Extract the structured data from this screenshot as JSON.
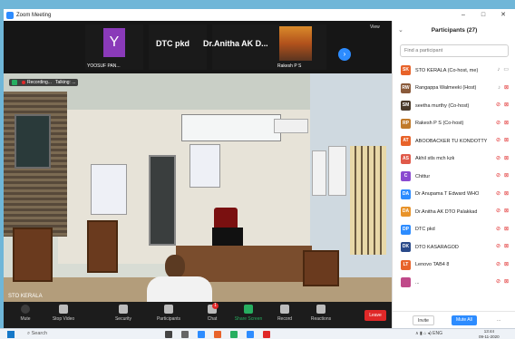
{
  "window": {
    "title": "Zoom Meeting",
    "controls": [
      "–",
      "□",
      "✕"
    ]
  },
  "gallery": {
    "tiles": [
      {
        "name": "YOOSUF PAN...",
        "avatar_letter": "Y",
        "avatar_color": "#8a3ab9"
      },
      {
        "name": "DTC pkd"
      },
      {
        "name": "Dr.Anitha AK D..."
      },
      {
        "name": "Rakesh P S"
      }
    ],
    "view_label": "View",
    "next_icon": "chevron-right-icon"
  },
  "main_video": {
    "recording_label": "Recording...",
    "talking_label": "Talking: ...",
    "speaker_name": "STO KERALA"
  },
  "toolbar": {
    "mute": "Mute",
    "stop_video": "Stop Video",
    "security": "Security",
    "participants": "Participants",
    "participants_count": "27",
    "chat": "Chat",
    "chat_badge": "1",
    "share_screen": "Share Screen",
    "record": "Record",
    "reactions": "Reactions",
    "leave": "Leave"
  },
  "panel": {
    "title": "Participants (27)",
    "search_placeholder": "Find a participant",
    "participants": [
      {
        "initials": "SK",
        "name": "STO KERALA (Co-host, me)",
        "color": "#e8632a",
        "mic_muted": false,
        "video_off": false
      },
      {
        "initials": "RW",
        "name": "Rangappa Walmeeki (Host)",
        "color": "#8a5a3a",
        "mic_muted": false,
        "video_off": true
      },
      {
        "initials": "SM",
        "name": "seetha murthy (Co-host)",
        "color": "#4a3a2a",
        "mic_muted": true,
        "video_off": true
      },
      {
        "initials": "RP",
        "name": "Rakesh P S (Co-host)",
        "color": "#c07a2a",
        "mic_muted": true,
        "video_off": true
      },
      {
        "initials": "AT",
        "name": "ABOOBACKER TU KONDOTTY",
        "color": "#e8632a",
        "mic_muted": true,
        "video_off": true
      },
      {
        "initials": "AS",
        "name": "Akhil stls mch kzk",
        "color": "#e05a4a",
        "mic_muted": true,
        "video_off": true
      },
      {
        "initials": "C",
        "name": "Chittur",
        "color": "#8a4ad0",
        "mic_muted": true,
        "video_off": true
      },
      {
        "initials": "DA",
        "name": "Dr Anupama T Edward WHO",
        "color": "#2d8cff",
        "mic_muted": true,
        "video_off": true
      },
      {
        "initials": "DA",
        "name": "Dr.Anitha AK DTO Palakkad",
        "color": "#e8932a",
        "mic_muted": true,
        "video_off": true
      },
      {
        "initials": "DP",
        "name": "DTC pkd",
        "color": "#2d8cff",
        "mic_muted": true,
        "video_off": true
      },
      {
        "initials": "DK",
        "name": "DTO KASARAGOD",
        "color": "#2a4a8a",
        "mic_muted": true,
        "video_off": true
      },
      {
        "initials": "LT",
        "name": "Lenovo TAB4 8",
        "color": "#e8632a",
        "mic_muted": true,
        "video_off": true
      },
      {
        "initials": "",
        "name": "...",
        "color": "#c04a8a",
        "mic_muted": true,
        "video_off": true
      }
    ],
    "invite": "Invite",
    "mute_all": "Mute All",
    "more": "..."
  },
  "taskbar": {
    "search": "Search",
    "tray": "ENG",
    "time": "13:44",
    "date": "09-11-2020"
  }
}
